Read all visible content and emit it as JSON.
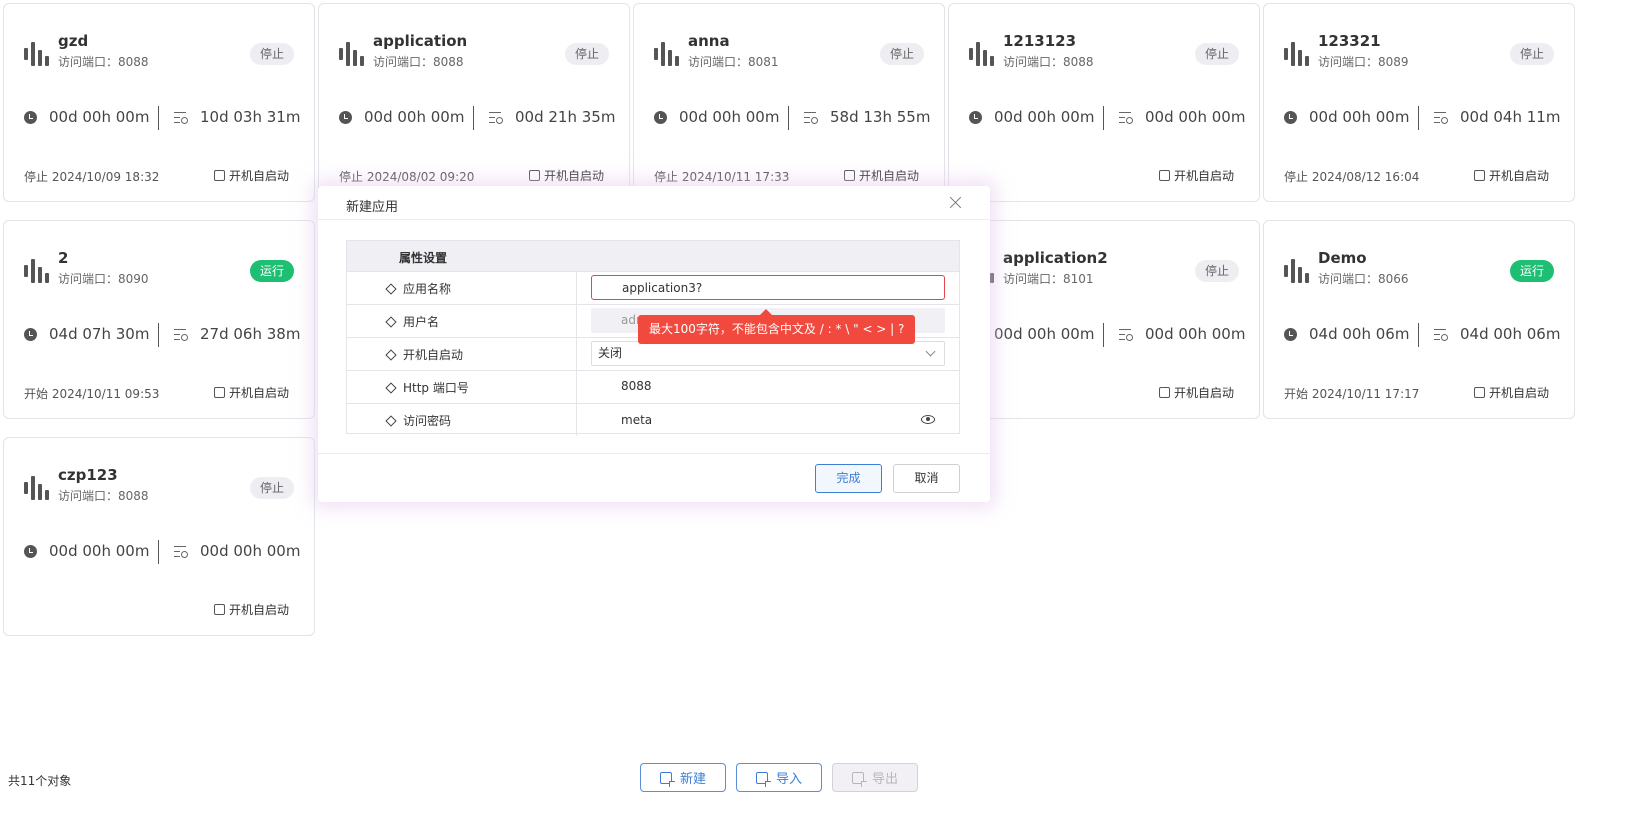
{
  "cards": [
    {
      "name": "gzd",
      "port": "访问端口：8088",
      "status": "停止",
      "running": false,
      "run_time": "00d 00h 00m",
      "total_time": "10d 03h 31m",
      "status_time": "停止 2024/10/09 18:32",
      "autostart": "开机自启动"
    },
    {
      "name": "application",
      "port": "访问端口：8088",
      "status": "停止",
      "running": false,
      "run_time": "00d 00h 00m",
      "total_time": "00d 21h 35m",
      "status_time": "停止 2024/08/02 09:20",
      "autostart": "开机自启动"
    },
    {
      "name": "anna",
      "port": "访问端口：8081",
      "status": "停止",
      "running": false,
      "run_time": "00d 00h 00m",
      "total_time": "58d 13h 55m",
      "status_time": "停止 2024/10/11 17:33",
      "autostart": "开机自启动"
    },
    {
      "name": "1213123",
      "port": "访问端口：8088",
      "status": "停止",
      "running": false,
      "run_time": "00d 00h 00m",
      "total_time": "00d 00h 00m",
      "status_time": "",
      "autostart": "开机自启动"
    },
    {
      "name": "123321",
      "port": "访问端口：8089",
      "status": "停止",
      "running": false,
      "run_time": "00d 00h 00m",
      "total_time": "00d 04h 11m",
      "status_time": "停止 2024/08/12 16:04",
      "autostart": "开机自启动"
    },
    {
      "name": "2",
      "port": "访问端口：8090",
      "status": "运行",
      "running": true,
      "run_time": "04d 07h 30m",
      "total_time": "27d 06h 38m",
      "status_time": "开始 2024/10/11 09:53",
      "autostart": "开机自启动"
    },
    {
      "name": "application2",
      "port": "访问端口：8101",
      "status": "停止",
      "running": false,
      "run_time": "00d 00h 00m",
      "total_time": "00d 00h 00m",
      "status_time": "",
      "autostart": "开机自启动"
    },
    {
      "name": "Demo",
      "port": "访问端口：8066",
      "status": "运行",
      "running": true,
      "run_time": "04d 00h 06m",
      "total_time": "04d 00h 06m",
      "status_time": "开始 2024/10/11 17:17",
      "autostart": "开机自启动"
    },
    {
      "name": "czp123",
      "port": "访问端口：8088",
      "status": "停止",
      "running": false,
      "run_time": "00d 00h 00m",
      "total_time": "00d 00h 00m",
      "status_time": "",
      "autostart": "开机自启动"
    }
  ],
  "modal": {
    "title": "新建应用",
    "section_header": "属性设置",
    "fields": {
      "app_name": {
        "label": "应用名称",
        "value": "application3?"
      },
      "username": {
        "label": "用户名",
        "value": "adr"
      },
      "autostart": {
        "label": "开机自启动",
        "value": "关闭"
      },
      "http_port": {
        "label": "Http 端口号",
        "value": "8088"
      },
      "password": {
        "label": "访问密码",
        "value": "meta"
      }
    },
    "error_tooltip": "最大100字符，不能包含中文及 / : * \\ \" < > | ?",
    "ok_label": "完成",
    "cancel_label": "取消"
  },
  "footer": {
    "count": "共11个对象",
    "new_label": "新建",
    "import_label": "导入",
    "export_label": "导出"
  },
  "colors": {
    "running": "#1fbf73",
    "error": "#f2493f",
    "accent": "#3d7fd6"
  }
}
